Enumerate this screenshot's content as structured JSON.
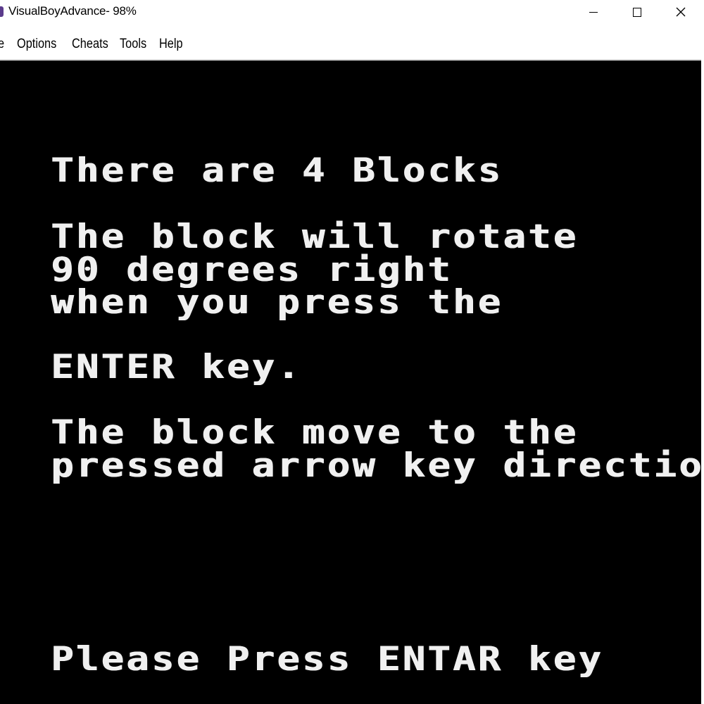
{
  "window": {
    "title": "VisualBoyAdvance- 98%",
    "controls": {
      "minimize_icon": "minimize-icon",
      "maximize_icon": "maximize-icon",
      "close_glyph": "X"
    }
  },
  "menubar": {
    "items": [
      {
        "label": "e"
      },
      {
        "label": "Options"
      },
      {
        "label": "Cheats"
      },
      {
        "label": "Tools"
      },
      {
        "label": "Help"
      }
    ]
  },
  "game": {
    "lines": [
      "There are 4 Blocks",
      "The block will rotate",
      "90 degrees right",
      "when you press the",
      "ENTER key.",
      "The block move to the",
      "pressed arrow key direction",
      "Please Press ENTAR key"
    ]
  },
  "colors": {
    "screen_background": "#000000",
    "screen_text": "#f0f0f0",
    "chrome_background": "#ffffff",
    "app_icon": "#5b3b8c"
  }
}
